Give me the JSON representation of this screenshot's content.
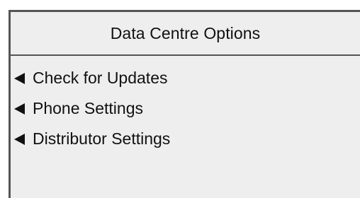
{
  "screen": {
    "title": "Data Centre Options"
  },
  "menu": {
    "items": [
      {
        "label": "Check for Updates",
        "icon": "left-arrow-icon"
      },
      {
        "label": "Phone Settings",
        "icon": "left-arrow-icon"
      },
      {
        "label": "Distributor Settings",
        "icon": "left-arrow-icon"
      }
    ]
  },
  "colors": {
    "background": "#eeeeee",
    "border": "#555555",
    "text": "#111111"
  }
}
